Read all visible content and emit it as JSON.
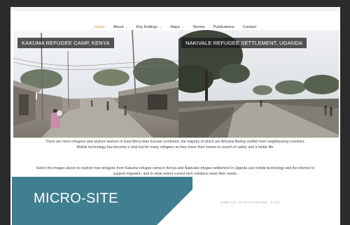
{
  "nav": {
    "items": [
      {
        "label": "Home",
        "active": true,
        "dropdown": false
      },
      {
        "label": "About",
        "active": false,
        "dropdown": true
      },
      {
        "label": "Key findings",
        "active": false,
        "dropdown": true
      },
      {
        "label": "Maps",
        "active": false,
        "dropdown": true
      },
      {
        "label": "Stories",
        "active": false,
        "dropdown": false
      },
      {
        "label": "Publications",
        "active": false,
        "dropdown": false
      },
      {
        "label": "Contact",
        "active": false,
        "dropdown": false
      }
    ],
    "chevron": "⌄"
  },
  "photos": {
    "left_caption": "KAKUMA REFUGEE CAMP, KENYA",
    "right_caption": "NAKIVALE REFUGEE SETTLEMENT, UGANDA"
  },
  "intro": {
    "line1": "There are more refugees and asylum seekers in East Africa than Europe combined, the majority of which are Africans fleeing conflict from neighbouring countries.",
    "line2": "Mobile technology has become a vital tool for many refugees as they leave their homes in search of safety and a better life."
  },
  "select_text": {
    "line1": "Select the images above to explore how refugees from Kakuma refugee camp in Kenya and Nakivale refugee settlement in Uganda use mobile technology and the internet to",
    "line2": "support migration, and to what extent current tech solutions meet their needs."
  },
  "footer": {
    "text": "Mobile Tech  ·  Mr Nurn WordPressite  ·  © 2018"
  },
  "badge": {
    "label": "MICRO-SITE"
  },
  "colors": {
    "active_nav": "#c89a38",
    "badge": "#3f7f8f",
    "background": "#2b2b2b"
  }
}
